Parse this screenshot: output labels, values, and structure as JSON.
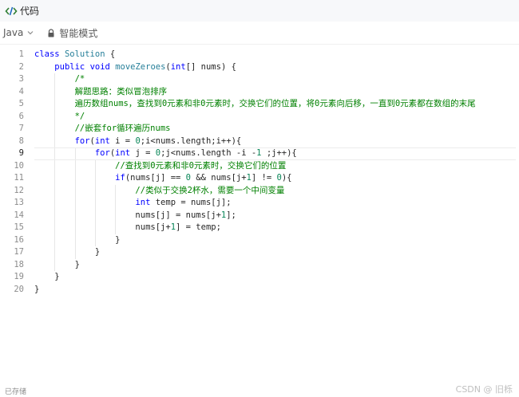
{
  "header": {
    "title": "代码"
  },
  "toolbar": {
    "language": "Java",
    "mode_label": "智能模式"
  },
  "editor": {
    "active_line": 9,
    "lines": [
      {
        "n": "1",
        "code": "class Solution {"
      },
      {
        "n": "2",
        "code": "    public void moveZeroes(int[] nums) {"
      },
      {
        "n": "3",
        "code": "        /*"
      },
      {
        "n": "4",
        "code": "        解题思路：类似冒泡排序"
      },
      {
        "n": "5",
        "code": "        遍历数组nums，查找到0元素和非0元素时，交换它们的位置，将0元素向后移，一直到0元素都在数组的末尾"
      },
      {
        "n": "6",
        "code": "        */"
      },
      {
        "n": "7",
        "code": "        //嵌套for循环遍历nums"
      },
      {
        "n": "8",
        "code": "        for(int i = 0;i<nums.length;i++){"
      },
      {
        "n": "9",
        "code": "            for(int j = 0;j<nums.length -i -1 ;j++){"
      },
      {
        "n": "10",
        "code": "                //查找到0元素和非0元素时，交换它们的位置"
      },
      {
        "n": "11",
        "code": "                if(nums[j] == 0 && nums[j+1] != 0){"
      },
      {
        "n": "12",
        "code": "                    //类似于交换2杯水，需要一个中间变量"
      },
      {
        "n": "13",
        "code": "                    int temp = nums[j];"
      },
      {
        "n": "14",
        "code": "                    nums[j] = nums[j+1];"
      },
      {
        "n": "15",
        "code": "                    nums[j+1] = temp;"
      },
      {
        "n": "16",
        "code": "                }"
      },
      {
        "n": "17",
        "code": "            }"
      },
      {
        "n": "18",
        "code": "        }"
      },
      {
        "n": "19",
        "code": "    }"
      },
      {
        "n": "20",
        "code": "}"
      }
    ]
  },
  "status": {
    "saved_label": "已存储"
  },
  "watermark": "CSDN @ 旧栎",
  "colors": {
    "keyword": "#0000ff",
    "type": "#267f99",
    "comment": "#008000",
    "number": "#098658",
    "text": "#262626"
  }
}
